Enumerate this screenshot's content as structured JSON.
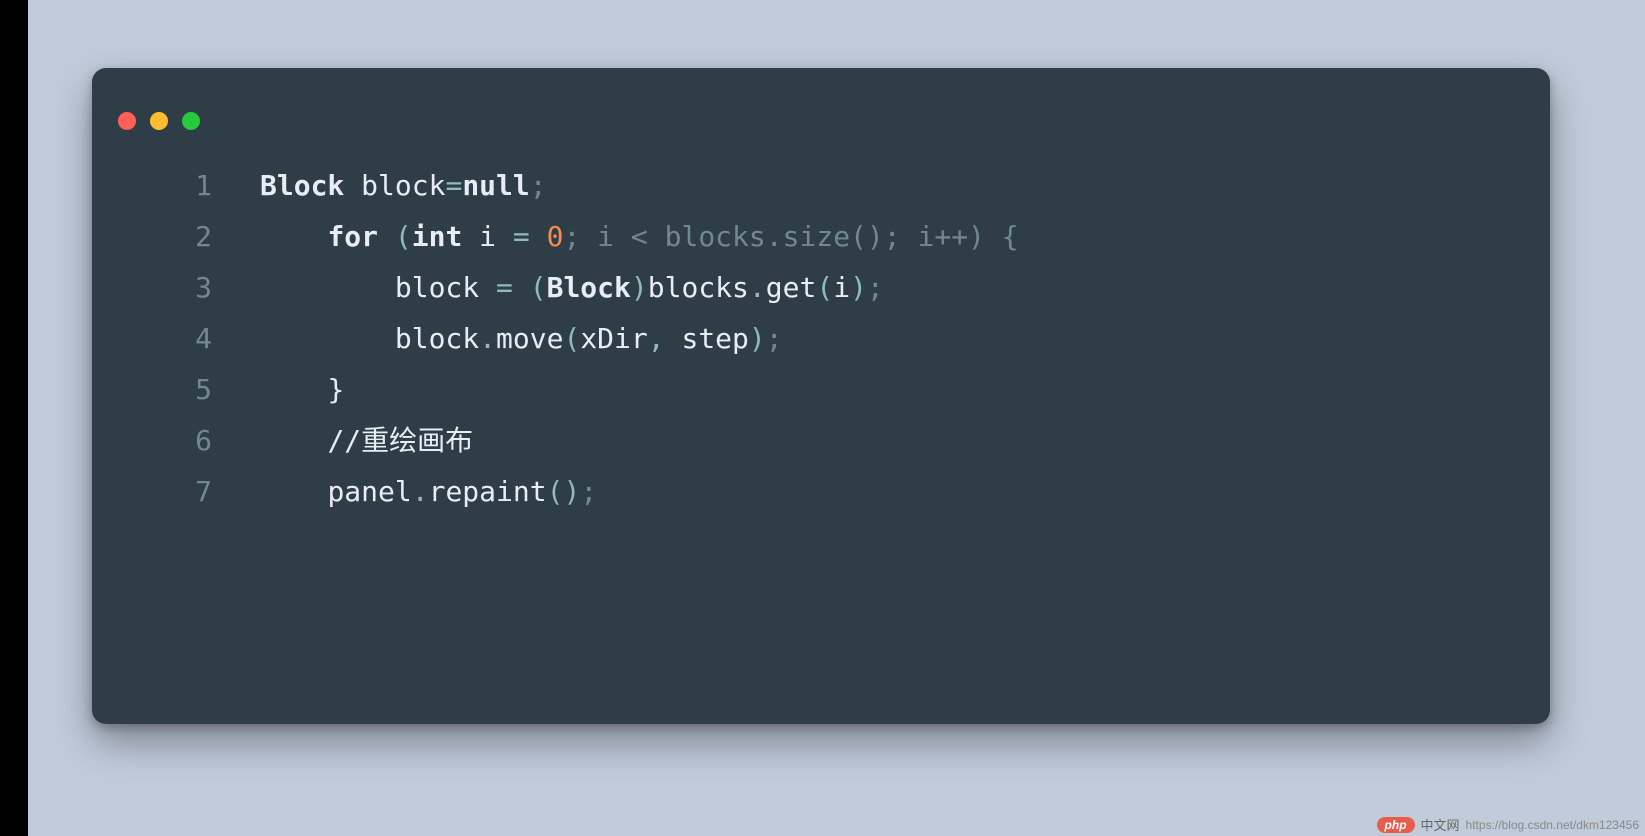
{
  "window": {
    "traffic_lights": [
      "red",
      "yellow",
      "green"
    ]
  },
  "code": {
    "lines": [
      {
        "num": "1",
        "tokens": [
          {
            "t": "Block",
            "c": "type"
          },
          {
            "t": " ",
            "c": "ident"
          },
          {
            "t": "block",
            "c": "ident"
          },
          {
            "t": "=",
            "c": "op"
          },
          {
            "t": "null",
            "c": "kw"
          },
          {
            "t": ";",
            "c": "dim"
          }
        ]
      },
      {
        "num": "2",
        "tokens": [
          {
            "t": "    ",
            "c": "ident"
          },
          {
            "t": "for",
            "c": "kw"
          },
          {
            "t": " ",
            "c": "ident"
          },
          {
            "t": "(",
            "c": "punct"
          },
          {
            "t": "int",
            "c": "type"
          },
          {
            "t": " ",
            "c": "ident"
          },
          {
            "t": "i",
            "c": "ident"
          },
          {
            "t": " ",
            "c": "ident"
          },
          {
            "t": "=",
            "c": "op"
          },
          {
            "t": " ",
            "c": "ident"
          },
          {
            "t": "0",
            "c": "num"
          },
          {
            "t": "; i < blocks.size(); i++) {",
            "c": "dim"
          }
        ]
      },
      {
        "num": "3",
        "tokens": [
          {
            "t": "        ",
            "c": "ident"
          },
          {
            "t": "block",
            "c": "ident"
          },
          {
            "t": " ",
            "c": "ident"
          },
          {
            "t": "=",
            "c": "op"
          },
          {
            "t": " ",
            "c": "ident"
          },
          {
            "t": "(",
            "c": "punct"
          },
          {
            "t": "Block",
            "c": "type"
          },
          {
            "t": ")",
            "c": "punct"
          },
          {
            "t": "blocks",
            "c": "ident"
          },
          {
            "t": ".",
            "c": "op"
          },
          {
            "t": "get",
            "c": "call"
          },
          {
            "t": "(",
            "c": "punct"
          },
          {
            "t": "i",
            "c": "ident"
          },
          {
            "t": ")",
            "c": "punct"
          },
          {
            "t": ";",
            "c": "dim"
          }
        ]
      },
      {
        "num": "4",
        "tokens": [
          {
            "t": "        ",
            "c": "ident"
          },
          {
            "t": "block",
            "c": "ident"
          },
          {
            "t": ".",
            "c": "op"
          },
          {
            "t": "move",
            "c": "call"
          },
          {
            "t": "(",
            "c": "punct"
          },
          {
            "t": "xDir",
            "c": "ident"
          },
          {
            "t": ",",
            "c": "op"
          },
          {
            "t": " ",
            "c": "ident"
          },
          {
            "t": "step",
            "c": "ident"
          },
          {
            "t": ")",
            "c": "punct"
          },
          {
            "t": ";",
            "c": "dim"
          }
        ]
      },
      {
        "num": "5",
        "tokens": [
          {
            "t": "    ",
            "c": "ident"
          },
          {
            "t": "}",
            "c": "ident"
          }
        ]
      },
      {
        "num": "6",
        "tokens": [
          {
            "t": "    ",
            "c": "ident"
          },
          {
            "t": "//重绘画布",
            "c": "comment"
          }
        ]
      },
      {
        "num": "7",
        "tokens": [
          {
            "t": "    ",
            "c": "ident"
          },
          {
            "t": "panel",
            "c": "ident"
          },
          {
            "t": ".",
            "c": "op"
          },
          {
            "t": "repaint",
            "c": "call"
          },
          {
            "t": "()",
            "c": "punct"
          },
          {
            "t": ";",
            "c": "dim"
          }
        ]
      }
    ]
  },
  "watermark": {
    "badge": "php",
    "label": "中文网",
    "url": "https://blog.csdn.net/dkm123456"
  }
}
